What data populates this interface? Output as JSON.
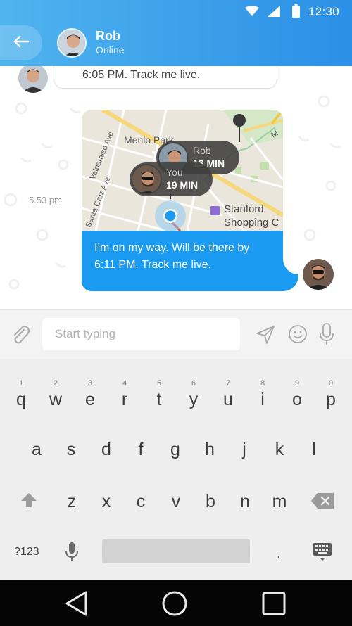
{
  "status_bar": {
    "time": "12:30"
  },
  "header": {
    "contact_name": "Rob",
    "contact_status": "Online"
  },
  "chat": {
    "prev_message_tail": "6:05 PM.  Track me live.",
    "timestamp": "5.53 pm",
    "map": {
      "labels": [
        "Menlo Park",
        "Valparaiso Ave",
        "Santa Cruz Ave",
        "Stanford",
        "Shopping C",
        "M"
      ],
      "pins": [
        {
          "name": "Rob",
          "eta": "13 MIN"
        },
        {
          "name": "You",
          "eta": "19 MIN"
        }
      ]
    },
    "outgoing_message": "I’m on my way. Will be there by 6:11 PM.  Track me live."
  },
  "input": {
    "placeholder": "Start typing"
  },
  "keyboard": {
    "row1": [
      {
        "d": "1",
        "l": "q"
      },
      {
        "d": "2",
        "l": "w"
      },
      {
        "d": "3",
        "l": "e"
      },
      {
        "d": "4",
        "l": "r"
      },
      {
        "d": "5",
        "l": "t"
      },
      {
        "d": "6",
        "l": "y"
      },
      {
        "d": "7",
        "l": "u"
      },
      {
        "d": "8",
        "l": "i"
      },
      {
        "d": "9",
        "l": "o"
      },
      {
        "d": "0",
        "l": "p"
      }
    ],
    "row2": [
      "a",
      "s",
      "d",
      "f",
      "g",
      "h",
      "j",
      "k",
      "l"
    ],
    "row3": [
      "z",
      "x",
      "c",
      "v",
      "b",
      "n",
      "m"
    ],
    "symbols": "?123",
    "period": "."
  },
  "colors": {
    "header_start": "#4fb4ee",
    "header_end": "#2b8fe6",
    "bubble": "#1a9af0",
    "accent": "#1a9af0"
  },
  "icons": [
    "back-arrow-icon",
    "wifi-icon",
    "signal-icon",
    "battery-icon",
    "attach-icon",
    "send-icon",
    "emoji-icon",
    "mic-icon",
    "shift-icon",
    "backspace-icon",
    "keyboard-icon",
    "nav-back-icon",
    "nav-home-icon",
    "nav-recents-icon"
  ]
}
